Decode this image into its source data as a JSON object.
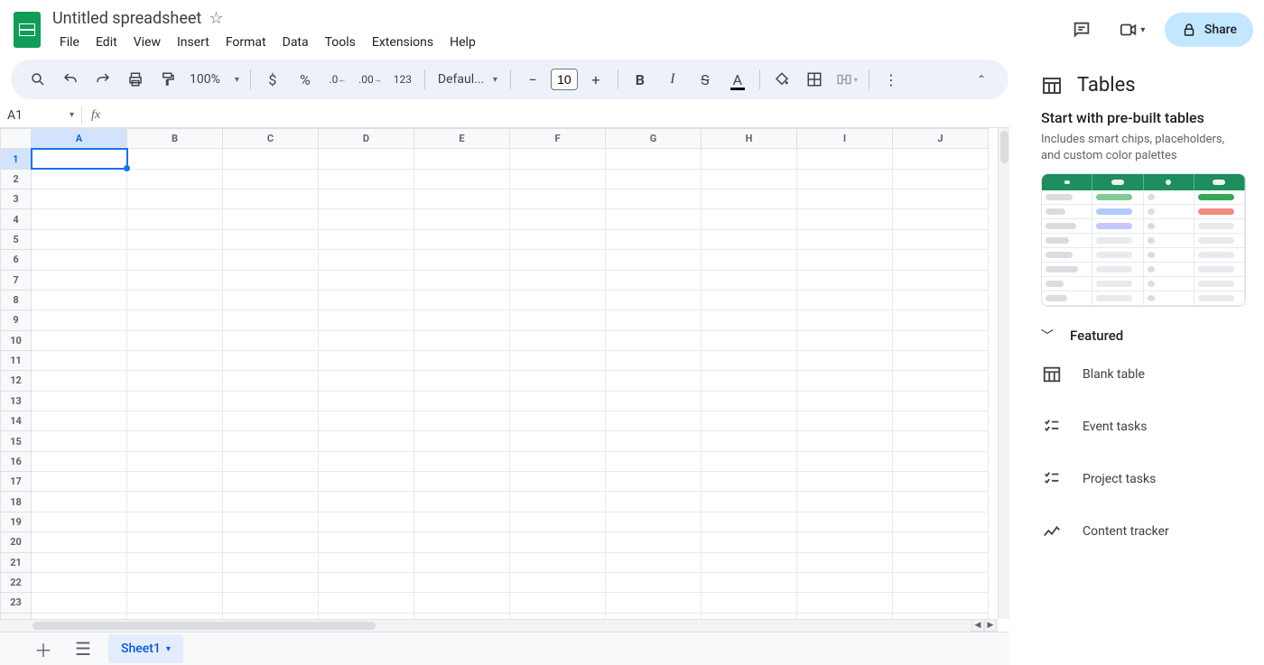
{
  "header": {
    "title": "Untitled spreadsheet",
    "menus": [
      "File",
      "Edit",
      "View",
      "Insert",
      "Format",
      "Data",
      "Tools",
      "Extensions",
      "Help"
    ],
    "share_label": "Share"
  },
  "toolbar": {
    "zoom": "100%",
    "font": "Defaul...",
    "font_size": "10",
    "number_label": "123"
  },
  "formula_bar": {
    "name_box": "A1",
    "formula": ""
  },
  "grid": {
    "columns": [
      "A",
      "B",
      "C",
      "D",
      "E",
      "F",
      "G",
      "H",
      "I",
      "J"
    ],
    "rows": 24,
    "active_cell": "A1"
  },
  "tabbar": {
    "active_sheet": "Sheet1"
  },
  "side_panel": {
    "title": "Tables",
    "start_heading": "Start with pre-built tables",
    "start_desc": "Includes smart chips, placeholders, and custom color palettes",
    "section_featured": "Featured",
    "options": [
      {
        "label": "Blank table",
        "icon": "table"
      },
      {
        "label": "Event tasks",
        "icon": "tasks"
      },
      {
        "label": "Project tasks",
        "icon": "tasks"
      },
      {
        "label": "Content tracker",
        "icon": "trend"
      }
    ]
  }
}
